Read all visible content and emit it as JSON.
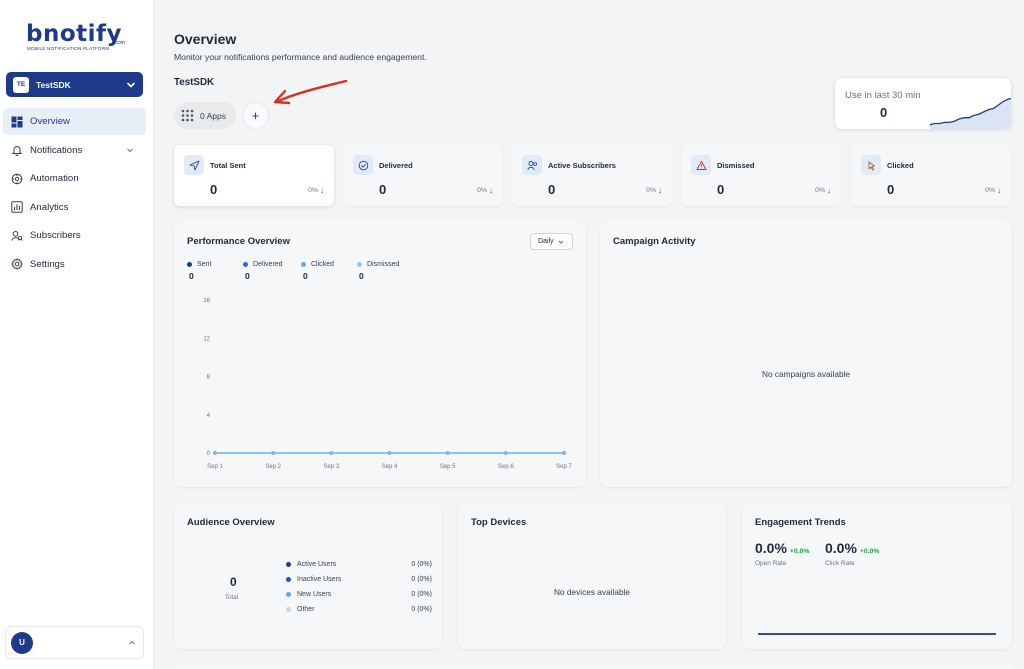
{
  "brand": {
    "logo_text": "bnotify",
    "logo_suffix": ".com",
    "tagline": "MOBILE NOTIFICATION PLATFORM"
  },
  "workspace": {
    "initials": "TE",
    "name": "TestSDK"
  },
  "nav": {
    "items": [
      {
        "label": "Overview",
        "icon": "dashboard-icon",
        "active": true
      },
      {
        "label": "Notifications",
        "icon": "bell-icon",
        "has_submenu": true
      },
      {
        "label": "Automation",
        "icon": "automation-icon"
      },
      {
        "label": "Analytics",
        "icon": "bar-chart-icon"
      },
      {
        "label": "Subscribers",
        "icon": "subscribers-icon"
      },
      {
        "label": "Settings",
        "icon": "gear-icon"
      }
    ]
  },
  "user": {
    "initial": "U"
  },
  "header": {
    "title": "Overview",
    "subtitle": "Monitor your notifications performance and audience engagement.",
    "app_name": "TestSDK",
    "apps_label": "0 Apps",
    "add_label": "+"
  },
  "usage": {
    "label": "Use in last 30 min",
    "value": "0",
    "sparkline": [
      2,
      3,
      3,
      4,
      4,
      5,
      7,
      8,
      8,
      10,
      11,
      13,
      15,
      16,
      19,
      22,
      24,
      25
    ]
  },
  "stats": [
    {
      "label": "Total Sent",
      "value": "0",
      "change": "0%",
      "icon": "send-icon"
    },
    {
      "label": "Delivered",
      "value": "0",
      "change": "0%",
      "icon": "check-circle-icon"
    },
    {
      "label": "Active Subscribers",
      "value": "0",
      "change": "0%",
      "icon": "users-icon"
    },
    {
      "label": "Dismissed",
      "value": "0",
      "change": "0%",
      "icon": "warning-icon"
    },
    {
      "label": "Clicked",
      "value": "0",
      "change": "0%",
      "icon": "pointer-icon"
    }
  ],
  "performance": {
    "title": "Performance Overview",
    "period": "Daily",
    "legend": [
      {
        "name": "Sent",
        "value": "0",
        "color": "#1e3a8a"
      },
      {
        "name": "Delivered",
        "value": "0",
        "color": "#2563eb"
      },
      {
        "name": "Clicked",
        "value": "0",
        "color": "#60a5fa"
      },
      {
        "name": "Dismissed",
        "value": "0",
        "color": "#93c5fd"
      }
    ]
  },
  "chart_data": {
    "type": "line",
    "title": "",
    "x": [
      "Sep 1",
      "Sep 2",
      "Sep 3",
      "Sep 4",
      "Sep 5",
      "Sep 6",
      "Sep 7"
    ],
    "series": [
      {
        "name": "Sent",
        "values": [
          0,
          0,
          0,
          0,
          0,
          0,
          0
        ]
      },
      {
        "name": "Delivered",
        "values": [
          0,
          0,
          0,
          0,
          0,
          0,
          0
        ]
      },
      {
        "name": "Clicked",
        "values": [
          0,
          0,
          0,
          0,
          0,
          0,
          0
        ]
      },
      {
        "name": "Dismissed",
        "values": [
          0,
          0,
          0,
          0,
          0,
          0,
          0
        ]
      }
    ],
    "yticks": [
      0,
      4,
      8,
      12,
      16
    ],
    "ylim": [
      0,
      16
    ],
    "xlabel": "",
    "ylabel": "",
    "grid": false,
    "line_color": "#7fb8e6"
  },
  "campaign": {
    "title": "Campaign Activity",
    "empty": "No campaigns available"
  },
  "audience": {
    "title": "Audience Overview",
    "total_value": "0",
    "total_label": "Total",
    "segments": [
      {
        "label": "Active Users",
        "value": "0 (0%)",
        "color": "#1e3a8a"
      },
      {
        "label": "Inactive Users",
        "value": "0 (0%)",
        "color": "#1d4ed8"
      },
      {
        "label": "New Users",
        "value": "0 (0%)",
        "color": "#60a5fa"
      },
      {
        "label": "Other",
        "value": "0 (0%)",
        "color": "#cbd5e1"
      }
    ]
  },
  "devices": {
    "title": "Top Devices",
    "empty": "No devices available"
  },
  "engagement": {
    "title": "Engagement Trends",
    "open_rate": {
      "value": "0.0%",
      "delta": "+0.0%",
      "label": "Open Rate"
    },
    "click_rate": {
      "value": "0.0%",
      "delta": "+0.0%",
      "label": "Click Rate"
    }
  }
}
